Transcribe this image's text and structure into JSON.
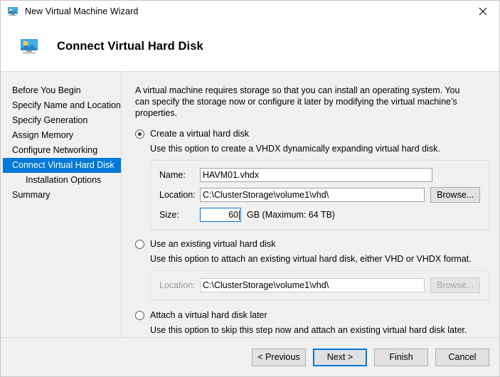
{
  "titlebar": {
    "title": "New Virtual Machine Wizard",
    "icon": "virtual-machine-icon",
    "close_label": "✕"
  },
  "header": {
    "title": "Connect Virtual Hard Disk",
    "icon": "virtual-machine-icon"
  },
  "sidebar": {
    "items": [
      {
        "label": "Before You Begin",
        "selected": false,
        "sub": false
      },
      {
        "label": "Specify Name and Location",
        "selected": false,
        "sub": false
      },
      {
        "label": "Specify Generation",
        "selected": false,
        "sub": false
      },
      {
        "label": "Assign Memory",
        "selected": false,
        "sub": false
      },
      {
        "label": "Configure Networking",
        "selected": false,
        "sub": false
      },
      {
        "label": "Connect Virtual Hard Disk",
        "selected": true,
        "sub": false
      },
      {
        "label": "Installation Options",
        "selected": false,
        "sub": true
      },
      {
        "label": "Summary",
        "selected": false,
        "sub": false
      }
    ]
  },
  "content": {
    "intro": "A virtual machine requires storage so that you can install an operating system. You can specify the storage now or configure it later by modifying the virtual machine’s properties.",
    "option_create": {
      "label": "Create a virtual hard disk",
      "selected": true,
      "description": "Use this option to create a VHDX dynamically expanding virtual hard disk.",
      "name_label": "Name:",
      "name_value": "HAVM01.vhdx",
      "location_label": "Location:",
      "location_value": "C:\\ClusterStorage\\volume1\\vhd\\",
      "browse_label": "Browse...",
      "size_label": "Size:",
      "size_value": "60",
      "size_suffix": "GB (Maximum: 64 TB)"
    },
    "option_existing": {
      "label": "Use an existing virtual hard disk",
      "selected": false,
      "description": "Use this option to attach an existing virtual hard disk, either VHD or VHDX format.",
      "location_label": "Location:",
      "location_value": "C:\\ClusterStorage\\volume1\\vhd\\",
      "browse_label": "Browse..."
    },
    "option_later": {
      "label": "Attach a virtual hard disk later",
      "selected": false,
      "description": "Use this option to skip this step now and attach an existing virtual hard disk later."
    }
  },
  "footer": {
    "previous_label": "< Previous",
    "next_label": "Next >",
    "finish_label": "Finish",
    "cancel_label": "Cancel"
  },
  "colors": {
    "accent": "#0078d7",
    "window_bg": "#f0f0f0",
    "panel_bg": "#ffffff"
  }
}
